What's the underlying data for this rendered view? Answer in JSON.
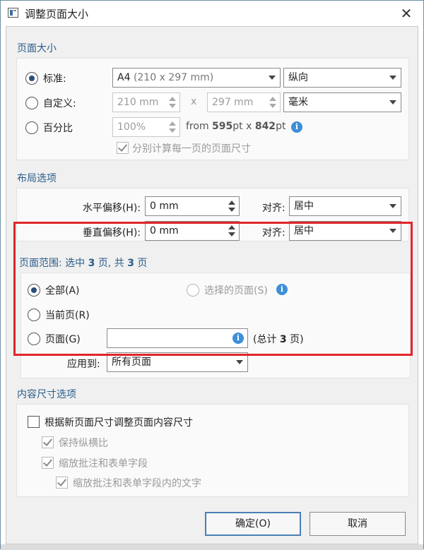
{
  "window": {
    "title": "调整页面大小",
    "close_label": "✕"
  },
  "page_size": {
    "title": "页面大小",
    "standard": {
      "label": "标准:",
      "size_prefix": "A4",
      "size_value": "(210 x 297 mm)",
      "orientation": "纵向"
    },
    "custom": {
      "label": "自定义:",
      "width": "210 mm",
      "x": "x",
      "height": "297 mm",
      "unit": "毫米"
    },
    "percent": {
      "label": "百分比",
      "value": "100%",
      "from_prefix": "from ",
      "from_w": "595",
      "from_unit1": "pt x ",
      "from_h": "842",
      "from_unit2": "pt"
    },
    "per_page_checkbox": "分别计算每一页的页面尺寸"
  },
  "layout": {
    "title": "布局选项",
    "h_offset": {
      "label": "水平偏移(H):",
      "value": "0 mm",
      "align_label": "对齐:",
      "align_value": "居中"
    },
    "v_offset": {
      "label": "垂直偏移(H):",
      "value": "0 mm",
      "align_label": "对齐:",
      "align_value": "居中"
    }
  },
  "range": {
    "title_prefix": "页面范围: 选中 ",
    "selected": "3",
    "title_mid": " 页, 共 ",
    "total": "3",
    "title_suffix": " 页",
    "all": "全部(A)",
    "selected_pages": "选择的页面(S)",
    "current": "当前页(R)",
    "pages": "页面(G)",
    "pages_value": "",
    "total_prefix": "(总计 ",
    "total_count": "3",
    "total_suffix": " 页)",
    "apply_label": "应用到:",
    "apply_value": "所有页面"
  },
  "content": {
    "title": "内容尺寸选项",
    "resize_content": "根据新页面尺寸调整页面内容尺寸",
    "keep_ratio": "保持纵横比",
    "scale_annots": "缩放批注和表单字段",
    "scale_annot_text": "缩放批注和表单字段内的文字"
  },
  "buttons": {
    "ok": "确定(O)",
    "cancel": "取消"
  },
  "colors": {
    "accent": "#2a5d8a",
    "highlight": "#e0262a",
    "info": "#3d8fd8"
  }
}
